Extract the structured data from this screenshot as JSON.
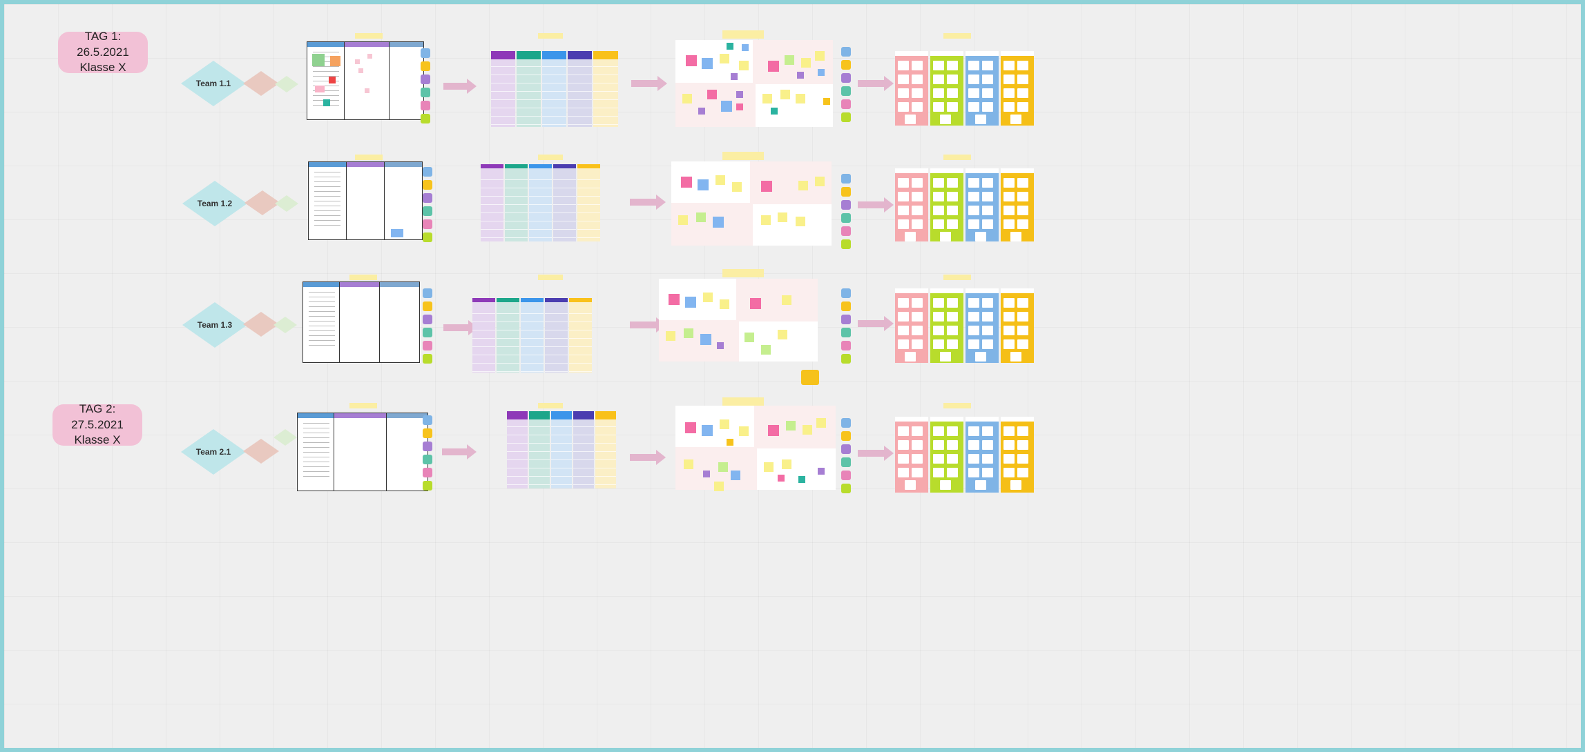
{
  "board": {
    "day_labels": [
      {
        "line1": "TAG 1: 26.5.2021",
        "line2": "Klasse X"
      },
      {
        "line1": "TAG 2: 27.5.2021",
        "line2": "Klasse X"
      }
    ],
    "teams": [
      {
        "name": "Team 1.1"
      },
      {
        "name": "Team 1.2"
      },
      {
        "name": "Team 1.3"
      },
      {
        "name": "Team 2.1"
      }
    ]
  },
  "colors": {
    "purple": "#a67ed3",
    "green": "#5dc3a8",
    "blue": "#4ea0e6",
    "indigo": "#5f5fb4",
    "yellow": "#f7c31c",
    "pink": "#f6a9ad",
    "lime": "#b8dc2c",
    "sky": "#7fb4e6",
    "gold": "#f5bf17",
    "arrow": "#e3b5cd",
    "day_label": "#f2c1d6",
    "diamond": "#bfe6ea"
  },
  "icons": [
    "diamond-shape",
    "arrow-right",
    "sticky-note",
    "kanban-frame"
  ]
}
